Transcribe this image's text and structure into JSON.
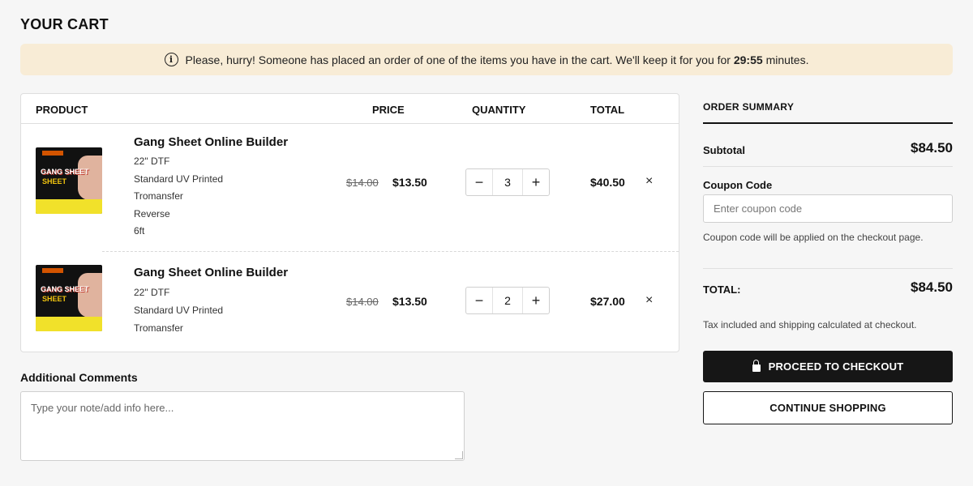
{
  "page": {
    "title": "YOUR CART"
  },
  "notice": {
    "icon": "info-icon",
    "text_before": "Please, hurry! Someone has placed an order of one of the items you have in the cart. We'll keep it for you for",
    "timer": "29:55",
    "text_after": "minutes."
  },
  "cart": {
    "headers": {
      "product": "PRODUCT",
      "price": "PRICE",
      "quantity": "QUANTITY",
      "total": "TOTAL"
    },
    "items": [
      {
        "name": "Gang Sheet Online Builder",
        "variants": [
          "22\" DTF",
          "Standard UV Printed",
          "Tromansfer",
          "Reverse",
          "6ft"
        ],
        "old_price": "$14.00",
        "price": "$13.50",
        "quantity": "3",
        "total": "$40.50"
      },
      {
        "name": "Gang Sheet Online Builder",
        "variants": [
          "22\" DTF",
          "Standard UV Printed",
          "Tromansfer"
        ],
        "old_price": "$14.00",
        "price": "$13.50",
        "quantity": "2",
        "total": "$27.00"
      }
    ],
    "qty_minus": "−",
    "qty_plus": "+",
    "remove_glyph": "×",
    "thumb_text_1": "GANG SHEET",
    "thumb_text_2": "SHEET"
  },
  "comments": {
    "label": "Additional Comments",
    "placeholder": "Type your note/add info here..."
  },
  "summary": {
    "title": "ORDER SUMMARY",
    "subtotal_label": "Subtotal",
    "subtotal_value": "$84.50",
    "coupon_label": "Coupon Code",
    "coupon_placeholder": "Enter coupon code",
    "coupon_note": "Coupon code will be applied on the checkout page.",
    "total_label": "TOTAL:",
    "total_value": "$84.50",
    "tax_note": "Tax included and shipping calculated at checkout.",
    "checkout_label": "PROCEED TO CHECKOUT",
    "continue_label": "CONTINUE SHOPPING"
  }
}
